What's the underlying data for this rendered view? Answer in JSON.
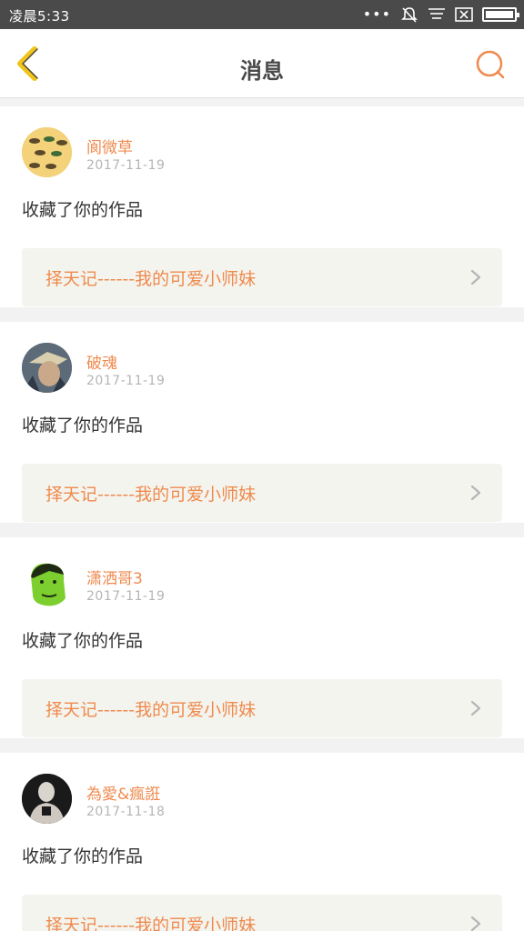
{
  "status": {
    "time": "凌晨5:33",
    "dots": "•••"
  },
  "header": {
    "title": "消息"
  },
  "messages": [
    {
      "name": "阆微草",
      "date": "2017-11-19",
      "text": "收藏了你的作品",
      "work": "择天记------我的可爱小师妹",
      "avatar_color": "#f3d27a"
    },
    {
      "name": "破魂",
      "date": "2017-11-19",
      "text": "收藏了你的作品",
      "work": "择天记------我的可爱小师妹",
      "avatar_color": "#6b7a88"
    },
    {
      "name": "潇洒哥3",
      "date": "2017-11-19",
      "text": "收藏了你的作品",
      "work": "择天记------我的可爱小师妹",
      "avatar_color": "#7ccf2e"
    },
    {
      "name": "為愛&瘋誑",
      "date": "2017-11-18",
      "text": "收藏了你的作品",
      "work": "择天记------我的可爱小师妹",
      "avatar_color": "#2a2a2a"
    }
  ],
  "colors": {
    "accent": "#ef8a4e",
    "back_icon": "#f0c419"
  }
}
